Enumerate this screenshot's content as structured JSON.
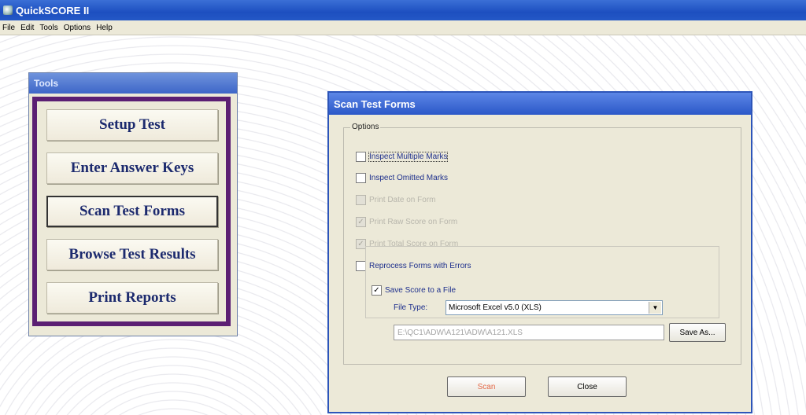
{
  "window": {
    "title": "QuickSCORE II"
  },
  "menu": [
    "File",
    "Edit",
    "Tools",
    "Options",
    "Help"
  ],
  "tools": {
    "title": "Tools",
    "buttons": [
      "Setup Test",
      "Enter Answer Keys",
      "Scan Test Forms",
      "Browse Test Results",
      "Print Reports"
    ]
  },
  "dialog": {
    "title": "Scan Test Forms",
    "options_label": "Options",
    "checkboxes": [
      {
        "label": "Inspect Multiple Marks",
        "checked": false,
        "enabled": true
      },
      {
        "label": "Inspect Omitted Marks",
        "checked": false,
        "enabled": true
      },
      {
        "label": "Print Date on Form",
        "checked": false,
        "enabled": false
      },
      {
        "label": "Print Raw Score on Form",
        "checked": true,
        "enabled": false
      },
      {
        "label": "Print Total Score on Form",
        "checked": true,
        "enabled": false
      },
      {
        "label": "Reprocess Forms with Errors",
        "checked": false,
        "enabled": true
      },
      {
        "label": "Save Score to a File",
        "checked": true,
        "enabled": true
      }
    ],
    "file_type_label": "File Type:",
    "file_type_value": "Microsoft Excel v5.0 (XLS)",
    "file_path": "E:\\QC1\\ADW\\A121\\ADW\\A121.XLS",
    "save_as_label": "Save As...",
    "scan_label": "Scan",
    "close_label": "Close"
  },
  "colors": {
    "title_bar": "#2458c6",
    "tools_frame": "#5b1f73",
    "tool_button_text": "#1c2a6e",
    "checkbox_text": "#1d2f8c",
    "scan_text": "#e46a4a"
  }
}
